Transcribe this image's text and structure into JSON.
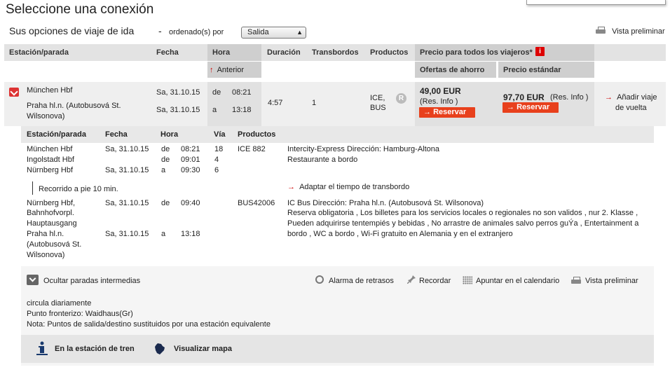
{
  "page": {
    "title": "Seleccione una conexión",
    "subtitle": "Sus opciones de viaje de ida",
    "dash": "-",
    "sorted_by": "ordenado(s) por",
    "sort_value": "Salida",
    "preview_label": "Vista preliminar"
  },
  "table_header": {
    "station": "Estación/parada",
    "date": "Fecha",
    "time": "Hora",
    "duration": "Duración",
    "transfers": "Transbordos",
    "products": "Productos",
    "price_all": "Precio para todos los viajeros*",
    "info_badge": "i",
    "previous": "Anterior",
    "savings": "Ofertas de ahorro",
    "standard": "Precio estándar"
  },
  "connection": {
    "from_station": "München Hbf",
    "to_station_line1": "Praha hl.n. (Autobusová St.",
    "to_station_line2": "Wilsonova)",
    "dep_date": "Sa, 31.10.15",
    "arr_date": "Sa, 31.10.15",
    "dep_prefix": "de",
    "arr_prefix": "a",
    "dep_time": "08:21",
    "arr_time": "13:18",
    "duration": "4:57",
    "transfers": "1",
    "product_1": "ICE,",
    "product_2": "BUS",
    "r_badge": "R",
    "saving_price": "49,00 EUR",
    "saving_info": "(Res. Info )",
    "standard_price": "97,70 EUR",
    "standard_info": "(Res. Info )",
    "reserve_label": "Reservar",
    "return_label_1": "Añadir viaje",
    "return_label_2": "de vuelta"
  },
  "detail_header": {
    "station": "Estación/parada",
    "date": "Fecha",
    "time": "Hora",
    "track": "Vía",
    "products": "Productos"
  },
  "legs": {
    "leg1": {
      "stops": [
        {
          "station": "München Hbf",
          "date": "Sa, 31.10.15",
          "prefix": "de",
          "time": "08:21",
          "track": "18"
        },
        {
          "station": "Ingolstadt Hbf",
          "date": "",
          "prefix": "de",
          "time": "09:01",
          "track": "4"
        },
        {
          "station": "Nürnberg Hbf",
          "date": "Sa, 31.10.15",
          "prefix": "a",
          "time": "09:30",
          "track": "6"
        }
      ],
      "product": "ICE 882",
      "description_1": "Intercity-Express Dirección: Hamburg-Altona",
      "description_2": "Restaurante a bordo"
    },
    "walk": "Recorrido a pie  10 min.",
    "adjust_transfer": "Adaptar el tiempo de transbordo",
    "leg2": {
      "from_1": "Nürnberg Hbf,",
      "from_2": "Bahnhofvorpl.",
      "from_3": "Hauptausgang",
      "from_date": "Sa, 31.10.15",
      "from_prefix": "de",
      "from_time": "09:40",
      "to_1": "Praha hl.n.",
      "to_2": "(Autobusová St.",
      "to_3": "Wilsonova)",
      "to_date": "Sa, 31.10.15",
      "to_prefix": "a",
      "to_time": "13:18",
      "product": "BUS42006",
      "description_1": "IC Bus Dirección: Praha hl.n. (Autobusová St. Wilsonova)",
      "description_2": "Reserva obligatoria , Los billetes para los servicios locales o regionales no son validos , nur 2. Klasse ,",
      "description_3": "Pueden adquirirse tentempiés y bebidas , No arrastre de animales salvo perros guÝa , Entertainment a",
      "description_4": "bordo , WC a bordo , Wi-Fi gratuito en Alemania y en el extranjero"
    }
  },
  "actions": {
    "hide_stops": "Ocultar paradas intermedias",
    "delay_alarm": "Alarma de retrasos",
    "remember": "Recordar",
    "calendar": "Apuntar en el calendario",
    "preview": "Vista preliminar"
  },
  "notes": {
    "line1": "circula diariamente",
    "line2": "Punto fronterizo: Waidhaus(Gr)",
    "line3": "Nota: Puntos de salida/destino sustituidos por una estación equivalente"
  },
  "footer": {
    "station_info": "En la estación de tren",
    "show_map": "Visualizar mapa"
  },
  "colors": {
    "accent_red": "#e8401c",
    "header_gray": "#e3e3e3",
    "highlight_gray": "#cfcfcf"
  },
  "icons": [
    "printer-icon",
    "info-icon",
    "toggle-expand-icon",
    "r-reservation-icon",
    "collapse-icon",
    "alarm-clock-icon",
    "pin-icon",
    "calendar-icon",
    "info-station-icon",
    "map-icon"
  ]
}
